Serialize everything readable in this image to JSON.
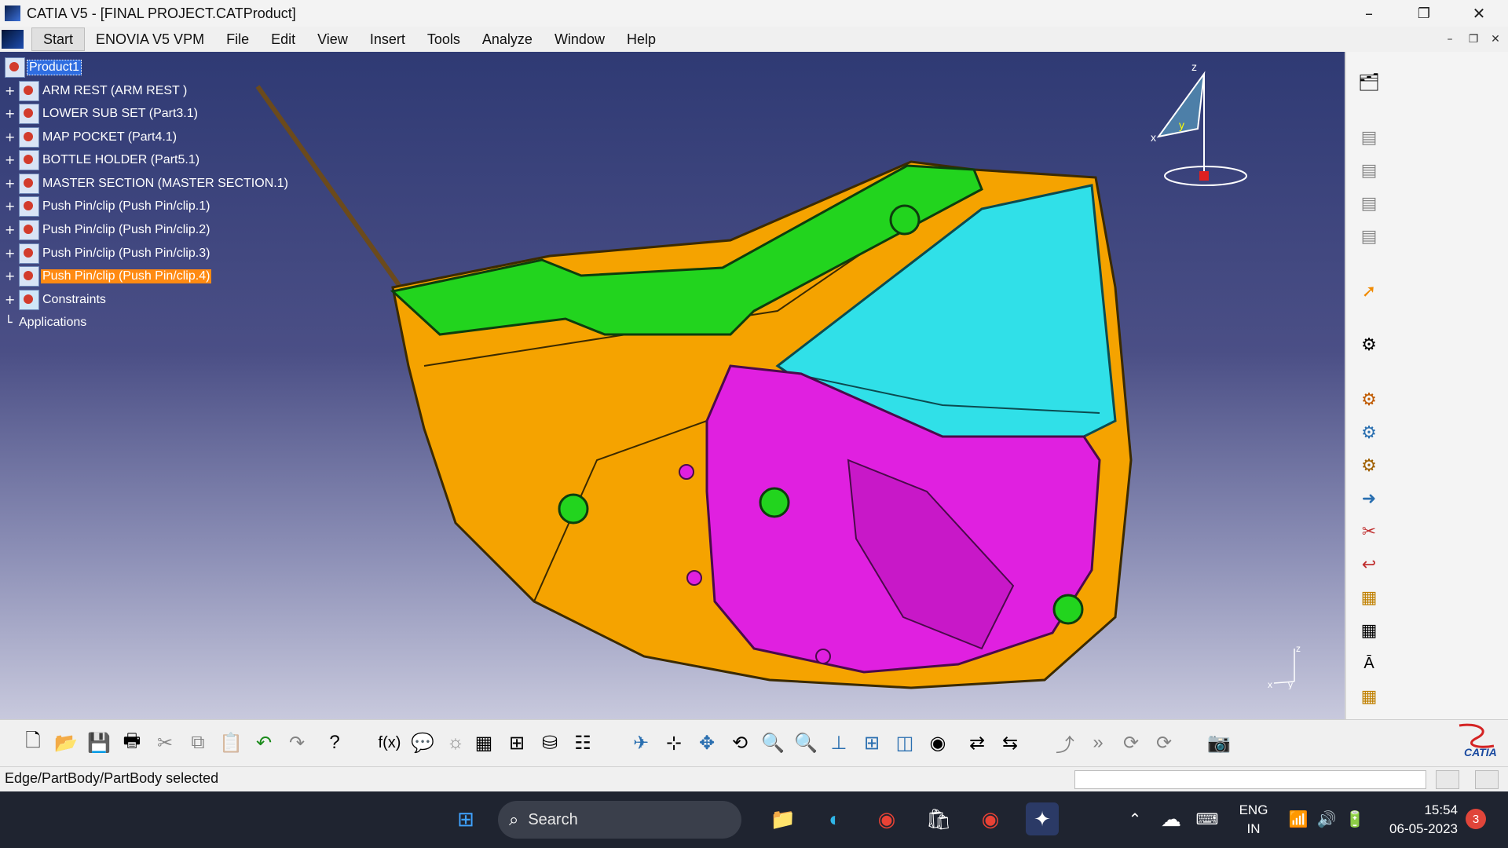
{
  "window": {
    "title": "CATIA V5 - [FINAL PROJECT.CATProduct]",
    "minimize_glyph": "–",
    "maximize_glyph": "❐",
    "close_glyph": "✕"
  },
  "menu": {
    "items": [
      {
        "label": "Start"
      },
      {
        "label": "ENOVIA V5 VPM"
      },
      {
        "label": "File"
      },
      {
        "label": "Edit"
      },
      {
        "label": "View"
      },
      {
        "label": "Insert"
      },
      {
        "label": "Tools"
      },
      {
        "label": "Analyze"
      },
      {
        "label": "Window"
      },
      {
        "label": "Help"
      }
    ]
  },
  "tree": {
    "root": "Product1",
    "nodes": [
      {
        "label": "ARM REST  (ARM REST )"
      },
      {
        "label": "LOWER SUB SET (Part3.1)"
      },
      {
        "label": "MAP POCKET (Part4.1)"
      },
      {
        "label": "BOTTLE HOLDER  (Part5.1)"
      },
      {
        "label": "MASTER SECTION (MASTER SECTION.1)"
      },
      {
        "label": "Push Pin/clip (Push Pin/clip.1)"
      },
      {
        "label": "Push Pin/clip (Push Pin/clip.2)"
      },
      {
        "label": "Push Pin/clip (Push Pin/clip.3)"
      },
      {
        "label": "Push Pin/clip (Push Pin/clip.4)"
      },
      {
        "label": "Constraints"
      },
      {
        "label": "Applications"
      }
    ]
  },
  "compass": {
    "z": "z",
    "x": "x",
    "y": "y"
  },
  "axis_triad": {
    "z": "z",
    "x": "x",
    "y": "y"
  },
  "brand": {
    "text": "CATIA"
  },
  "status": {
    "message": "Edge/PartBody/PartBody selected"
  },
  "taskbar": {
    "search_label": "Search",
    "lang_line1": "ENG",
    "lang_line2": "IN",
    "time": "15:54",
    "date": "06-05-2023",
    "notifications": "3"
  },
  "colors": {
    "part_orange": "#f5a300",
    "part_magenta": "#e020e0",
    "part_cyan": "#30e0e8",
    "part_green": "#22d41e",
    "viewport_top": "#2f3a74",
    "selection_orange": "#ff8a12"
  }
}
